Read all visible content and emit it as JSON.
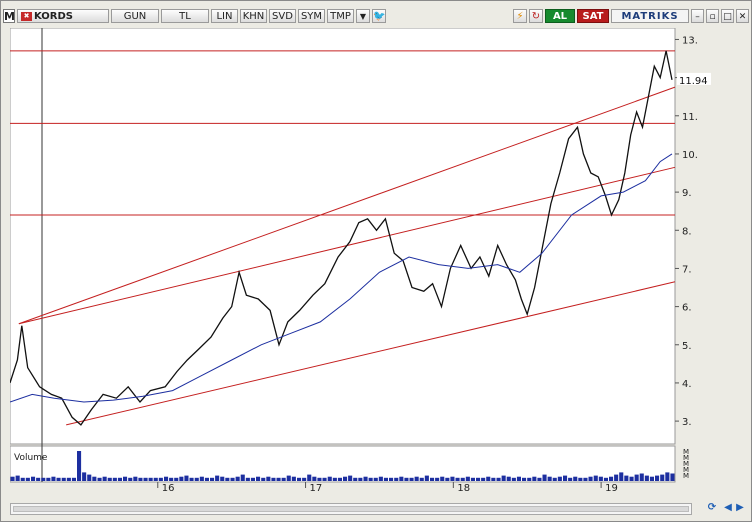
{
  "toolbar": {
    "logo": "M",
    "symbol": "KORDS",
    "period": "GUN",
    "currency": "TL",
    "scale": "LIN",
    "b1": "KHN",
    "b2": "SVD",
    "b3": "SYM",
    "b4": "TMP",
    "buy": "AL",
    "sell": "SAT",
    "brand": "MATRIKS",
    "colors": {
      "buy": "#168a2e",
      "sell": "#b81c1c"
    }
  },
  "chart_data": {
    "type": "line",
    "symbol": "KORDS",
    "last_price": "11.94",
    "y_ticks": [
      "13.",
      "12.",
      "11.",
      "10.",
      "9.",
      "8.",
      "7.",
      "6.",
      "5.",
      "4.",
      "3."
    ],
    "x_ticks": [
      "16",
      "17",
      "18",
      "19"
    ],
    "ylim": [
      2.4,
      13.3
    ],
    "xlim": [
      2015.0,
      2019.5
    ],
    "volume_label": "Volume",
    "volume_ticks": [
      "M",
      "M",
      "M",
      "M",
      "M"
    ],
    "series": [
      {
        "values": [
          [
            2015.0,
            4.0
          ],
          [
            2015.05,
            4.6
          ],
          [
            2015.08,
            5.5
          ],
          [
            2015.12,
            4.4
          ],
          [
            2015.2,
            3.9
          ],
          [
            2015.28,
            3.7
          ],
          [
            2015.35,
            3.6
          ],
          [
            2015.42,
            3.1
          ],
          [
            2015.48,
            2.9
          ],
          [
            2015.55,
            3.3
          ],
          [
            2015.63,
            3.7
          ],
          [
            2015.72,
            3.6
          ],
          [
            2015.8,
            3.9
          ],
          [
            2015.88,
            3.5
          ],
          [
            2015.95,
            3.8
          ],
          [
            2016.05,
            3.9
          ],
          [
            2016.13,
            4.3
          ],
          [
            2016.2,
            4.6
          ],
          [
            2016.28,
            4.9
          ],
          [
            2016.36,
            5.2
          ],
          [
            2016.44,
            5.7
          ],
          [
            2016.5,
            6.0
          ],
          [
            2016.55,
            6.9
          ],
          [
            2016.6,
            6.3
          ],
          [
            2016.68,
            6.2
          ],
          [
            2016.76,
            5.9
          ],
          [
            2016.82,
            5.0
          ],
          [
            2016.88,
            5.6
          ],
          [
            2016.96,
            5.9
          ],
          [
            2017.05,
            6.3
          ],
          [
            2017.13,
            6.6
          ],
          [
            2017.22,
            7.3
          ],
          [
            2017.3,
            7.7
          ],
          [
            2017.36,
            8.2
          ],
          [
            2017.42,
            8.3
          ],
          [
            2017.48,
            8.0
          ],
          [
            2017.54,
            8.3
          ],
          [
            2017.6,
            7.4
          ],
          [
            2017.66,
            7.2
          ],
          [
            2017.72,
            6.5
          ],
          [
            2017.8,
            6.4
          ],
          [
            2017.86,
            6.6
          ],
          [
            2017.92,
            6.0
          ],
          [
            2017.98,
            7.0
          ],
          [
            2018.05,
            7.6
          ],
          [
            2018.12,
            7.0
          ],
          [
            2018.18,
            7.3
          ],
          [
            2018.24,
            6.8
          ],
          [
            2018.3,
            7.6
          ],
          [
            2018.36,
            7.1
          ],
          [
            2018.42,
            6.7
          ],
          [
            2018.46,
            6.2
          ],
          [
            2018.5,
            5.8
          ],
          [
            2018.55,
            6.5
          ],
          [
            2018.6,
            7.5
          ],
          [
            2018.66,
            8.7
          ],
          [
            2018.72,
            9.5
          ],
          [
            2018.78,
            10.4
          ],
          [
            2018.84,
            10.7
          ],
          [
            2018.88,
            10.0
          ],
          [
            2018.93,
            9.5
          ],
          [
            2018.98,
            9.4
          ],
          [
            2019.03,
            8.9
          ],
          [
            2019.07,
            8.4
          ],
          [
            2019.12,
            8.8
          ],
          [
            2019.16,
            9.5
          ],
          [
            2019.2,
            10.5
          ],
          [
            2019.24,
            11.1
          ],
          [
            2019.28,
            10.7
          ],
          [
            2019.32,
            11.5
          ],
          [
            2019.36,
            12.3
          ],
          [
            2019.4,
            12.0
          ],
          [
            2019.44,
            12.7
          ],
          [
            2019.48,
            11.94
          ]
        ]
      },
      {
        "values": [
          [
            2015.0,
            3.5
          ],
          [
            2015.15,
            3.7
          ],
          [
            2015.3,
            3.6
          ],
          [
            2015.5,
            3.5
          ],
          [
            2015.7,
            3.55
          ],
          [
            2015.9,
            3.65
          ],
          [
            2016.1,
            3.8
          ],
          [
            2016.3,
            4.2
          ],
          [
            2016.5,
            4.6
          ],
          [
            2016.7,
            5.0
          ],
          [
            2016.9,
            5.3
          ],
          [
            2017.1,
            5.6
          ],
          [
            2017.3,
            6.2
          ],
          [
            2017.5,
            6.9
          ],
          [
            2017.7,
            7.3
          ],
          [
            2017.9,
            7.1
          ],
          [
            2018.1,
            7.0
          ],
          [
            2018.3,
            7.1
          ],
          [
            2018.45,
            6.9
          ],
          [
            2018.6,
            7.4
          ],
          [
            2018.8,
            8.4
          ],
          [
            2019.0,
            8.9
          ],
          [
            2019.15,
            9.0
          ],
          [
            2019.3,
            9.3
          ],
          [
            2019.4,
            9.8
          ],
          [
            2019.48,
            10.0
          ]
        ]
      }
    ],
    "horizontal_lines": [
      12.7,
      10.8,
      8.4
    ],
    "trend_lines": [
      [
        [
          2015.06,
          5.55
        ],
        [
          2019.5,
          11.75
        ]
      ],
      [
        [
          2015.06,
          5.55
        ],
        [
          2019.5,
          9.65
        ]
      ],
      [
        [
          2015.38,
          2.9
        ],
        [
          2019.5,
          6.65
        ]
      ]
    ],
    "volume_values": [
      4,
      5,
      3,
      3,
      4,
      3,
      3,
      3,
      4,
      3,
      3,
      3,
      3,
      28,
      8,
      6,
      4,
      3,
      4,
      3,
      3,
      3,
      4,
      3,
      4,
      3,
      3,
      3,
      3,
      3,
      4,
      3,
      3,
      4,
      5,
      3,
      3,
      4,
      3,
      3,
      5,
      4,
      3,
      3,
      4,
      6,
      3,
      3,
      4,
      3,
      4,
      3,
      3,
      3,
      5,
      4,
      3,
      3,
      6,
      4,
      3,
      3,
      4,
      3,
      3,
      4,
      5,
      3,
      3,
      4,
      3,
      3,
      4,
      3,
      3,
      3,
      4,
      3,
      3,
      4,
      3,
      5,
      3,
      3,
      4,
      3,
      4,
      3,
      3,
      4,
      3,
      3,
      3,
      4,
      3,
      3,
      5,
      4,
      3,
      4,
      3,
      3,
      4,
      3,
      6,
      4,
      3,
      4,
      5,
      3,
      4,
      3,
      3,
      4,
      5,
      4,
      3,
      4,
      6,
      8,
      5,
      4,
      6,
      7,
      5,
      4,
      5,
      6,
      8,
      7
    ]
  }
}
